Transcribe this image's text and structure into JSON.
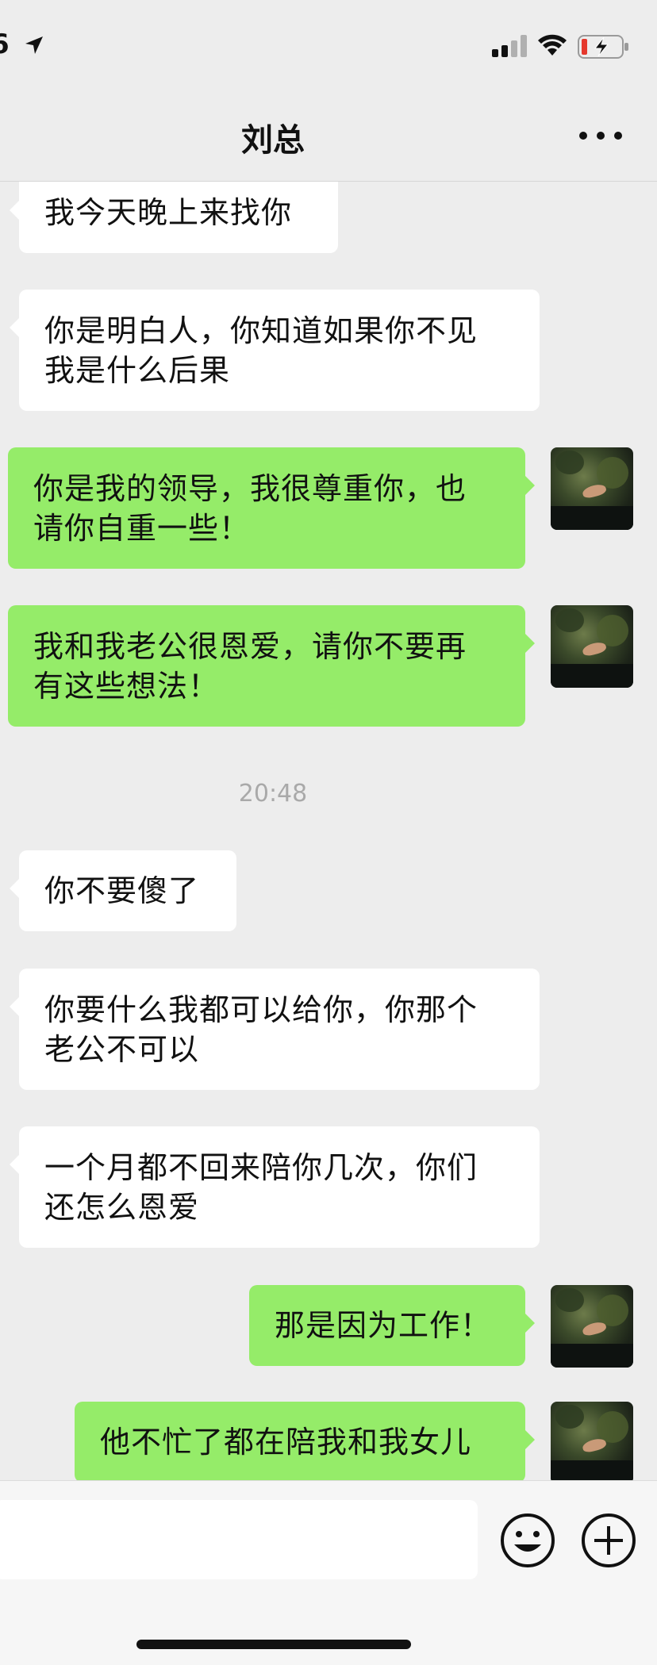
{
  "status_bar": {
    "time": "6"
  },
  "header": {
    "title": "刘总"
  },
  "messages": [
    {
      "side": "in",
      "text": "我今天晚上来找你"
    },
    {
      "side": "in",
      "text": "你是明白人，你知道如果你不见\n我是什么后果"
    },
    {
      "side": "out",
      "text": "你是我的领导，我很尊重你，也\n请你自重一些！"
    },
    {
      "side": "out",
      "text": "我和我老公很恩爱，请你不要再\n有这些想法！"
    },
    {
      "side": "in",
      "text": "你不要傻了"
    },
    {
      "side": "in",
      "text": "你要什么我都可以给你，你那个\n老公不可以"
    },
    {
      "side": "in",
      "text": "一个月都不回来陪你几次，你们\n还怎么恩爱"
    },
    {
      "side": "out",
      "text": "那是因为工作！"
    },
    {
      "side": "out",
      "text": "他不忙了都在陪我和我女儿"
    }
  ],
  "timestamp": "20:48",
  "icons": {
    "location": "location-arrow-icon",
    "signal": "cellular-signal-icon",
    "wifi": "wifi-icon",
    "battery": "battery-low-charging-icon",
    "more": "more-dots-icon",
    "emoji": "emoji-icon",
    "plus": "plus-icon"
  },
  "colors": {
    "incoming_bubble": "#ffffff",
    "outgoing_bubble": "#95ec69",
    "background": "#ededed",
    "battery_low": "#e5382d"
  }
}
